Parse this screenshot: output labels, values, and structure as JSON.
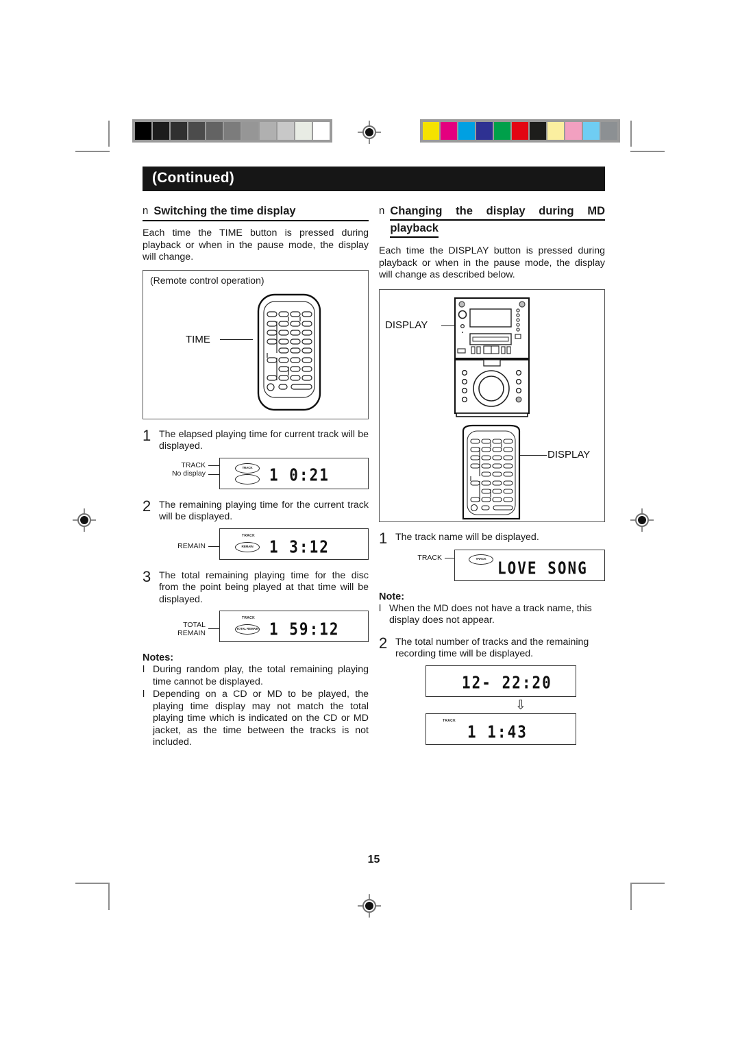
{
  "page": {
    "number": "15",
    "continued_label": "(Continued)"
  },
  "calibration": {
    "gray_swatches": [
      "#000000",
      "#1c1c1c",
      "#303030",
      "#4b4b4b",
      "#636363",
      "#7c7c7c",
      "#969696",
      "#b0b0b0",
      "#c8c8c8",
      "#e8ece4",
      "#ffffff"
    ],
    "color_swatches": [
      "#f5e200",
      "#e4007f",
      "#00a0e2",
      "#2e3192",
      "#00a04a",
      "#e30613",
      "#1d1d1b",
      "#fbefa0",
      "#f2a0c0",
      "#6fcdf3",
      "#8c9093"
    ]
  },
  "left_column": {
    "heading_bullet": "n",
    "heading": "Switching the time display",
    "intro": "Each time the TIME button is pressed during playback or when in the pause mode, the display will change.",
    "figure_caption": "(Remote control operation)",
    "remote_callout": "TIME",
    "steps": [
      {
        "num": "1",
        "text": "The elapsed playing time for current track will be displayed.",
        "labels": [
          "TRACK",
          "No display"
        ],
        "indicators": [
          "TRACK",
          ""
        ],
        "segment": "1    0:21"
      },
      {
        "num": "2",
        "text": "The remaining playing time for the current track will be displayed.",
        "labels": [
          "REMAIN"
        ],
        "indicators": [
          "REMAIN"
        ],
        "top_tag": "TRACK",
        "segment": "1    3:12"
      },
      {
        "num": "3",
        "text": "The total remaining playing time for the disc from the point being played at that time will be displayed.",
        "labels": [
          "TOTAL",
          "REMAIN"
        ],
        "indicators": [
          "TOTAL REMAIN"
        ],
        "top_tag": "TRACK",
        "segment": "1   59:12"
      }
    ],
    "notes_title": "Notes:",
    "notes": [
      "During random play, the total remaining playing time cannot be displayed.",
      "Depending on a CD or MD to be played, the playing time display may not match the total playing time which is indicated on the CD or MD jacket, as the time between the tracks is not included."
    ]
  },
  "right_column": {
    "heading_bullet": "n",
    "heading_line1": "Changing the display during MD",
    "heading_line2": "playback",
    "intro": "Each time the DISPLAY button is pressed during playback or when in the pause mode, the display will change as described below.",
    "unit_callout": "DISPLAY",
    "remote_callout": "DISPLAY",
    "steps": [
      {
        "num": "1",
        "text": "The track name will be displayed.",
        "labels": [
          "TRACK"
        ],
        "indicators": [
          "TRACK"
        ],
        "segment": "LOVE SONG"
      },
      {
        "num": "2",
        "text": "The total number of tracks and the remaining recording time will be displayed.",
        "segment_top": "12-  22:20",
        "arrow": "⇩",
        "top_tag": "TRACK",
        "segment_bottom": "1     1:43"
      }
    ],
    "note_title": "Note:",
    "notes": [
      "When the MD does not have a track name, this display does not appear."
    ]
  }
}
